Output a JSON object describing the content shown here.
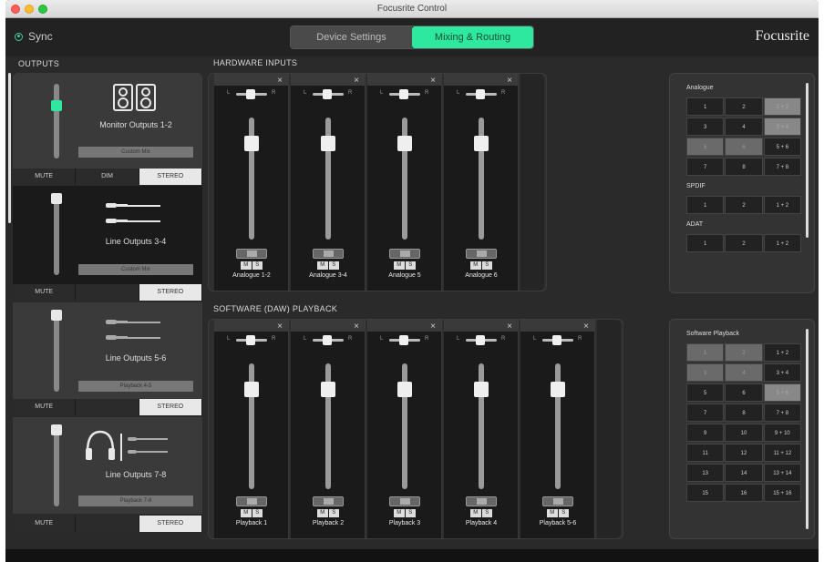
{
  "window": {
    "title": "Focusrite Control"
  },
  "topbar": {
    "sync_label": "Sync",
    "tabs": [
      "Device Settings",
      "Mixing & Routing"
    ],
    "active_tab": 1,
    "brand": "Focusrite",
    "accent_color": "#2fe8a0"
  },
  "outputs": {
    "section_label": "OUTPUTS",
    "blocks": [
      {
        "name": "Monitor Outputs 1-2",
        "source": "Custom Mix",
        "icon": "speakers-icon",
        "buttons": [
          "MUTE",
          "DIM",
          "STEREO"
        ],
        "level": 0.8
      },
      {
        "name": "Line Outputs 3-4",
        "source": "Custom Mix",
        "icon": "cables-icon",
        "buttons": [
          "MUTE",
          "STEREO"
        ],
        "level": 1.0
      },
      {
        "name": "Line Outputs 5-6",
        "source": "Playback 4-5",
        "icon": "cables-icon",
        "buttons": [
          "MUTE",
          "STEREO"
        ],
        "level": 1.0
      },
      {
        "name": "Line Outputs 7-8",
        "source": "Playback 7-8",
        "icon": "headphones-icon",
        "buttons": [
          "MUTE",
          "STEREO"
        ],
        "level": 1.0
      }
    ]
  },
  "hardware_inputs": {
    "section_label": "HARDWARE INPUTS",
    "strips": [
      {
        "name": "Analogue 1-2"
      },
      {
        "name": "Analogue 3-4"
      },
      {
        "name": "Analogue 5"
      },
      {
        "name": "Analogue 6"
      }
    ]
  },
  "software_playback": {
    "section_label": "SOFTWARE (DAW) PLAYBACK",
    "strips": [
      {
        "name": "Playback 1"
      },
      {
        "name": "Playback 2"
      },
      {
        "name": "Playback 3"
      },
      {
        "name": "Playback 4"
      },
      {
        "name": "Playback 5-6"
      }
    ]
  },
  "strip_controls": {
    "mute": "M",
    "solo": "S",
    "pan_left": "L",
    "pan_right": "R",
    "close": "×"
  },
  "input_grid": {
    "groups": [
      {
        "title": "Analogue",
        "rows": [
          [
            "1",
            "2",
            "1 + 2"
          ],
          [
            "3",
            "4",
            "3 + 4"
          ],
          [
            "5",
            "6",
            "5 + 6"
          ],
          [
            "7",
            "8",
            "7 + 8"
          ]
        ]
      },
      {
        "title": "SPDIF",
        "rows": [
          [
            "1",
            "2",
            "1 + 2"
          ]
        ]
      },
      {
        "title": "ADAT",
        "rows": [
          [
            "1",
            "2",
            "1 + 2"
          ]
        ]
      }
    ]
  },
  "playback_grid": {
    "title": "Software Playback",
    "rows": [
      [
        "1",
        "2",
        "1 + 2"
      ],
      [
        "3",
        "4",
        "3 + 4"
      ],
      [
        "5",
        "6",
        "5 + 6"
      ],
      [
        "7",
        "8",
        "7 + 8"
      ],
      [
        "9",
        "10",
        "9 + 10"
      ],
      [
        "11",
        "12",
        "11 + 12"
      ],
      [
        "13",
        "14",
        "13 + 14"
      ],
      [
        "15",
        "16",
        "15 + 16"
      ]
    ]
  }
}
